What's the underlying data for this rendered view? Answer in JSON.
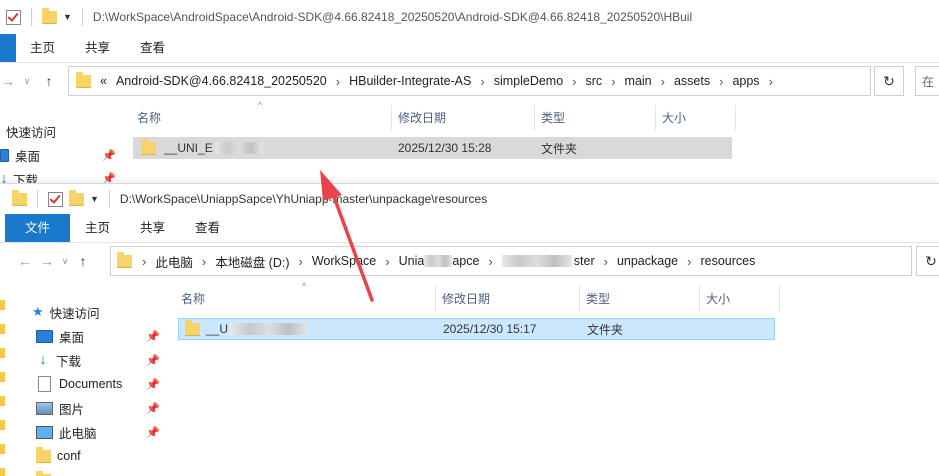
{
  "win1": {
    "title": "D:\\WorkSpace\\AndroidSpace\\Android-SDK@4.66.82418_20250520\\Android-SDK@4.66.82418_20250520\\HBuil",
    "ribbon": [
      "主页",
      "共享",
      "查看"
    ],
    "address_overflow": "«",
    "crumbs": [
      "Android-SDK@4.66.82418_20250520",
      "HBuilder-Integrate-AS",
      "simpleDemo",
      "src",
      "main",
      "assets",
      "apps"
    ],
    "search_placeholder": "在",
    "quick_access": "快速访问",
    "nav": [
      "桌面",
      "下载"
    ],
    "columns": [
      "名称",
      "修改日期",
      "类型",
      "大小"
    ],
    "rows": [
      {
        "name": "__UNI_E",
        "date": "2025/12/30 15:28",
        "type": "文件夹",
        "size": ""
      }
    ]
  },
  "win2": {
    "title": "D:\\WorkSpace\\UniappSapce\\YhUniapp-master\\unpackage\\resources",
    "ribbon": [
      "文件",
      "主页",
      "共享",
      "查看"
    ],
    "crumbs": [
      "此电脑",
      "本地磁盘 (D:)",
      "WorkSpace",
      "Unia",
      "apce",
      "ster",
      "unpackage",
      "resources"
    ],
    "quick_access": "快速访问",
    "nav": [
      "桌面",
      "下载",
      "Documents",
      "图片",
      "此电脑",
      "conf"
    ],
    "columns": [
      "名称",
      "修改日期",
      "类型",
      "大小"
    ],
    "rows": [
      {
        "name": "__U",
        "date": "2025/12/30 15:17",
        "type": "文件夹",
        "size": ""
      }
    ]
  },
  "icons": {
    "back": "back-arrow-icon",
    "forward": "forward-arrow-icon",
    "up": "up-arrow-icon",
    "refresh": "refresh-icon",
    "pin": "pin-icon",
    "quick_access": "star-icon",
    "annotation": "red-arrow-annotation"
  },
  "colors": {
    "file_tab": "#1979ca",
    "selection": "#cce8ff",
    "selection_border": "#99d1ff",
    "selection_gray": "#d9d9d9",
    "annotation": "#e8434a"
  }
}
